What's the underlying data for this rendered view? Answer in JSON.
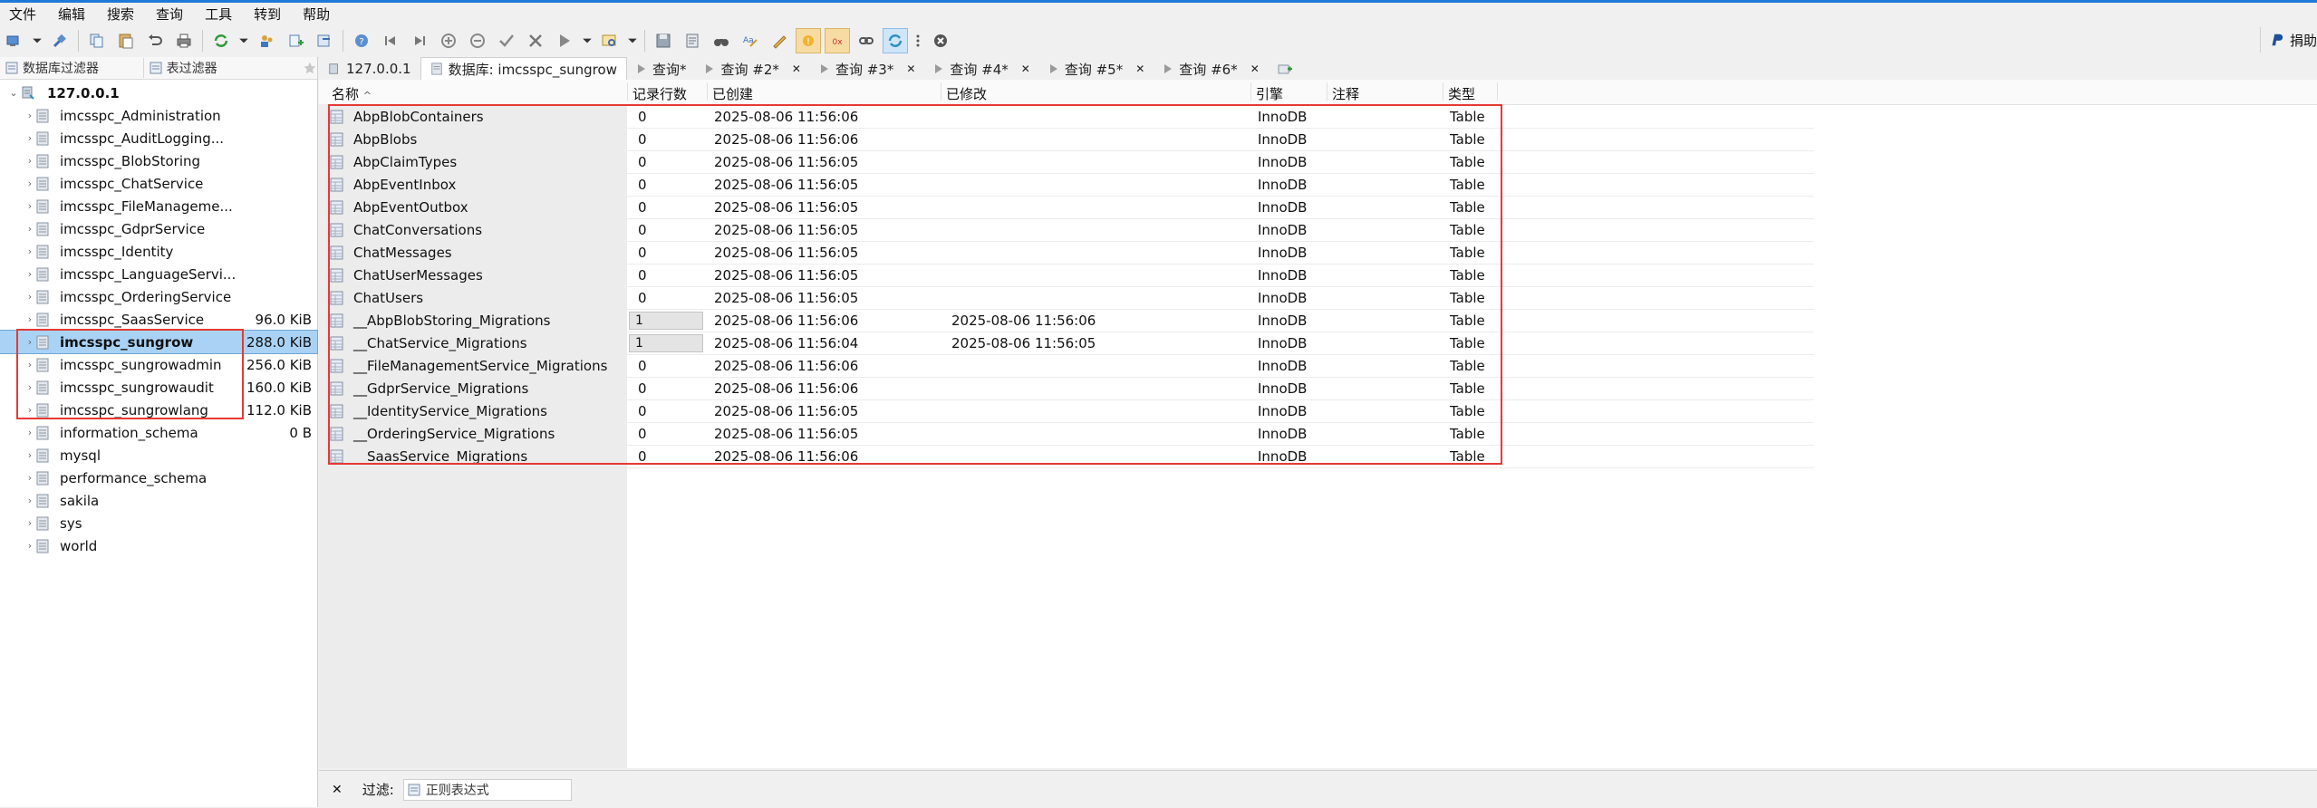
{
  "menu": [
    "文件",
    "编辑",
    "搜索",
    "查询",
    "工具",
    "转到",
    "帮助"
  ],
  "toolbar": {
    "donate_label": "捐助"
  },
  "left_panel": {
    "db_filter": "数据库过滤器",
    "table_filter": "表过滤器",
    "server": "127.0.0.1",
    "databases": [
      {
        "name": "imcsspc_Administration",
        "size": ""
      },
      {
        "name": "imcsspc_AuditLogging...",
        "size": ""
      },
      {
        "name": "imcsspc_BlobStoring",
        "size": ""
      },
      {
        "name": "imcsspc_ChatService",
        "size": ""
      },
      {
        "name": "imcsspc_FileManageme...",
        "size": ""
      },
      {
        "name": "imcsspc_GdprService",
        "size": ""
      },
      {
        "name": "imcsspc_Identity",
        "size": ""
      },
      {
        "name": "imcsspc_LanguageServi...",
        "size": ""
      },
      {
        "name": "imcsspc_OrderingService",
        "size": ""
      },
      {
        "name": "imcsspc_SaasService",
        "size": "96.0 KiB"
      },
      {
        "name": "imcsspc_sungrow",
        "size": "288.0 KiB"
      },
      {
        "name": "imcsspc_sungrowadmin",
        "size": "256.0 KiB"
      },
      {
        "name": "imcsspc_sungrowaudit",
        "size": "160.0 KiB"
      },
      {
        "name": "imcsspc_sungrowlang",
        "size": "112.0 KiB"
      },
      {
        "name": "information_schema",
        "size": "0 B"
      },
      {
        "name": "mysql",
        "size": ""
      },
      {
        "name": "performance_schema",
        "size": ""
      },
      {
        "name": "sakila",
        "size": ""
      },
      {
        "name": "sys",
        "size": ""
      },
      {
        "name": "world",
        "size": ""
      }
    ]
  },
  "tabs": [
    {
      "label": "127.0.0.1",
      "active": false,
      "closable": false
    },
    {
      "label": "数据库: imcsspc_sungrow",
      "active": true,
      "closable": false
    },
    {
      "label": "查询*",
      "active": false,
      "closable": false
    },
    {
      "label": "查询 #2*",
      "active": false,
      "closable": true
    },
    {
      "label": "查询 #3*",
      "active": false,
      "closable": true
    },
    {
      "label": "查询 #4*",
      "active": false,
      "closable": true
    },
    {
      "label": "查询 #5*",
      "active": false,
      "closable": true
    },
    {
      "label": "查询 #6*",
      "active": false,
      "closable": true
    }
  ],
  "table": {
    "columns": {
      "name": "名称",
      "sort": "^",
      "rows": "记录行数",
      "created": "已创建",
      "modified": "已修改",
      "engine": "引擎",
      "comment": "注释",
      "type": "类型"
    },
    "rows": [
      {
        "name": "AbpBlobContainers",
        "rows": "0",
        "created": "2025-08-06 11:56:06",
        "modified": "",
        "engine": "InnoDB",
        "comment": "",
        "type": "Table"
      },
      {
        "name": "AbpBlobs",
        "rows": "0",
        "created": "2025-08-06 11:56:06",
        "modified": "",
        "engine": "InnoDB",
        "comment": "",
        "type": "Table"
      },
      {
        "name": "AbpClaimTypes",
        "rows": "0",
        "created": "2025-08-06 11:56:05",
        "modified": "",
        "engine": "InnoDB",
        "comment": "",
        "type": "Table"
      },
      {
        "name": "AbpEventInbox",
        "rows": "0",
        "created": "2025-08-06 11:56:05",
        "modified": "",
        "engine": "InnoDB",
        "comment": "",
        "type": "Table"
      },
      {
        "name": "AbpEventOutbox",
        "rows": "0",
        "created": "2025-08-06 11:56:05",
        "modified": "",
        "engine": "InnoDB",
        "comment": "",
        "type": "Table"
      },
      {
        "name": "ChatConversations",
        "rows": "0",
        "created": "2025-08-06 11:56:05",
        "modified": "",
        "engine": "InnoDB",
        "comment": "",
        "type": "Table"
      },
      {
        "name": "ChatMessages",
        "rows": "0",
        "created": "2025-08-06 11:56:05",
        "modified": "",
        "engine": "InnoDB",
        "comment": "",
        "type": "Table"
      },
      {
        "name": "ChatUserMessages",
        "rows": "0",
        "created": "2025-08-06 11:56:05",
        "modified": "",
        "engine": "InnoDB",
        "comment": "",
        "type": "Table"
      },
      {
        "name": "ChatUsers",
        "rows": "0",
        "created": "2025-08-06 11:56:05",
        "modified": "",
        "engine": "InnoDB",
        "comment": "",
        "type": "Table"
      },
      {
        "name": "__AbpBlobStoring_Migrations",
        "rows": "1",
        "created": "2025-08-06 11:56:06",
        "modified": "2025-08-06 11:56:06",
        "engine": "InnoDB",
        "comment": "",
        "type": "Table"
      },
      {
        "name": "__ChatService_Migrations",
        "rows": "1",
        "created": "2025-08-06 11:56:04",
        "modified": "2025-08-06 11:56:05",
        "engine": "InnoDB",
        "comment": "",
        "type": "Table"
      },
      {
        "name": "__FileManagementService_Migrations",
        "rows": "0",
        "created": "2025-08-06 11:56:06",
        "modified": "",
        "engine": "InnoDB",
        "comment": "",
        "type": "Table"
      },
      {
        "name": "__GdprService_Migrations",
        "rows": "0",
        "created": "2025-08-06 11:56:06",
        "modified": "",
        "engine": "InnoDB",
        "comment": "",
        "type": "Table"
      },
      {
        "name": "__IdentityService_Migrations",
        "rows": "0",
        "created": "2025-08-06 11:56:05",
        "modified": "",
        "engine": "InnoDB",
        "comment": "",
        "type": "Table"
      },
      {
        "name": "__OrderingService_Migrations",
        "rows": "0",
        "created": "2025-08-06 11:56:05",
        "modified": "",
        "engine": "InnoDB",
        "comment": "",
        "type": "Table"
      },
      {
        "name": "__SaasService_Migrations",
        "rows": "0",
        "created": "2025-08-06 11:56:06",
        "modified": "",
        "engine": "InnoDB",
        "comment": "",
        "type": "Table"
      }
    ]
  },
  "bottom_filter": {
    "label": "过滤:",
    "placeholder": "正则表达式"
  },
  "colors": {
    "selection": "#a9d2f5",
    "annotation_box": "#e53935",
    "accent": "#1e78d7"
  }
}
